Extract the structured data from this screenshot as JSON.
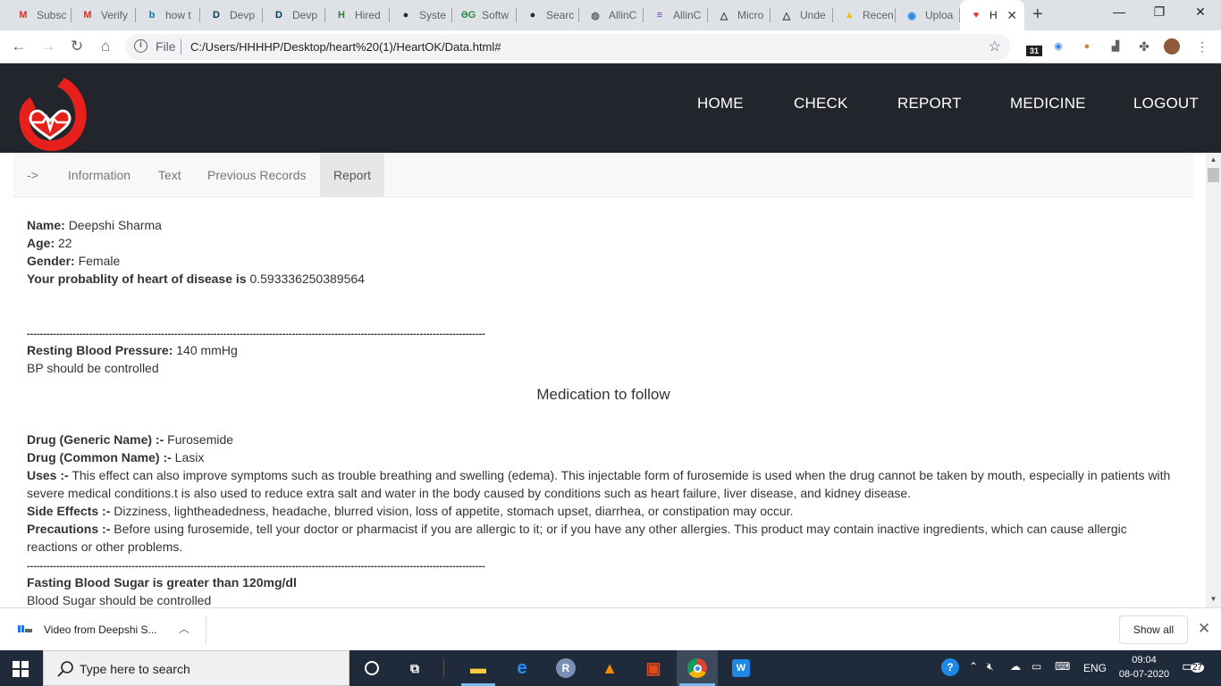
{
  "browser": {
    "tabs": [
      {
        "label": "Subsc",
        "icon": "gmail-icon",
        "glyph": "M",
        "color": "#d93025"
      },
      {
        "label": "Verify",
        "icon": "gmail-icon",
        "glyph": "M",
        "color": "#d93025"
      },
      {
        "label": "how t",
        "icon": "bing-icon",
        "glyph": "b",
        "color": "#00809d"
      },
      {
        "label": "Devp",
        "icon": "devpost-icon",
        "glyph": "D",
        "color": "#003e54"
      },
      {
        "label": "Devp",
        "icon": "devpost-icon",
        "glyph": "D",
        "color": "#003e54"
      },
      {
        "label": "Hired",
        "icon": "hired-icon",
        "glyph": "H",
        "color": "#2e7d32"
      },
      {
        "label": "Syste",
        "icon": "github-icon",
        "glyph": "●",
        "color": "#24292e"
      },
      {
        "label": "Softw",
        "icon": "geeks-icon",
        "glyph": "ƏG",
        "color": "#2f8d46"
      },
      {
        "label": "Searc",
        "icon": "github-icon",
        "glyph": "●",
        "color": "#24292e"
      },
      {
        "label": "AllinC",
        "icon": "globe-icon",
        "glyph": "◍",
        "color": "#5f6368"
      },
      {
        "label": "AllinC",
        "icon": "form-icon",
        "glyph": "≡",
        "color": "#673ab7"
      },
      {
        "label": "Micro",
        "icon": "drive-icon",
        "glyph": "△",
        "color": "#3c4043"
      },
      {
        "label": "Unde",
        "icon": "drive-icon",
        "glyph": "△",
        "color": "#3c4043"
      },
      {
        "label": "Recen",
        "icon": "drive-color-icon",
        "glyph": "▲",
        "color": "#fbbc04"
      },
      {
        "label": "Uploa",
        "icon": "upload-icon",
        "glyph": "◉",
        "color": "#1e88e5"
      },
      {
        "label": "H",
        "icon": "heart-icon",
        "glyph": "♥",
        "color": "#e53935",
        "active": true
      }
    ],
    "file_label": "File",
    "url": "C:/Users/HHHHP/Desktop/heart%20(1)/HeartOK/Data.html#",
    "calendar_badge": "31"
  },
  "site": {
    "nav": [
      "HOME",
      "CHECK",
      "REPORT",
      "MEDICINE",
      "LOGOUT"
    ],
    "subtabs": [
      "->",
      "Information",
      "Text",
      "Previous Records",
      "Report"
    ],
    "active_subtab": "Report"
  },
  "report": {
    "name_label": "Name:",
    "name": "Deepshi Sharma",
    "age_label": "Age:",
    "age": "22",
    "gender_label": "Gender:",
    "gender": "Female",
    "prob_label": "Your probablity of heart of disease is",
    "prob": "0.593336250389564",
    "divider": "--------------------------------------------------------------------------------------------------------------------------------------------",
    "bp_label": "Resting Blood Pressure:",
    "bp": "140 mmHg",
    "bp_note": "BP should be controlled",
    "medication_heading": "Medication to follow",
    "drug_generic_label": "Drug (Generic Name) :-",
    "drug_generic": "Furosemide",
    "drug_common_label": "Drug (Common Name) :-",
    "drug_common": "Lasix",
    "uses_label": "Uses :-",
    "uses": "This effect can also improve symptoms such as trouble breathing and swelling (edema). This injectable form of furosemide is used when the drug cannot be taken by mouth, especially in patients with severe medical conditions.t is also used to reduce extra salt and water in the body caused by conditions such as heart failure, liver disease, and kidney disease.",
    "side_label": "Side Effects :-",
    "side": "Dizziness, lightheadedness, headache, blurred vision, loss of appetite, stomach upset, diarrhea, or constipation may occur.",
    "prec_label": "Precautions :-",
    "prec": "Before using furosemide, tell your doctor or pharmacist if you are allergic to it; or if you have any other allergies. This product may contain inactive ingredients, which can cause allergic reactions or other problems.",
    "sugar_label": "Fasting Blood Sugar is greater than 120mg/dl",
    "sugar_note": "Blood Sugar should be controlled"
  },
  "download": {
    "item": "Video from Deepshi S...",
    "show_all": "Show all"
  },
  "taskbar": {
    "search_placeholder": "Type here to search",
    "lang": "ENG",
    "time": "09:04",
    "date": "08-07-2020",
    "notif_count": "27"
  }
}
